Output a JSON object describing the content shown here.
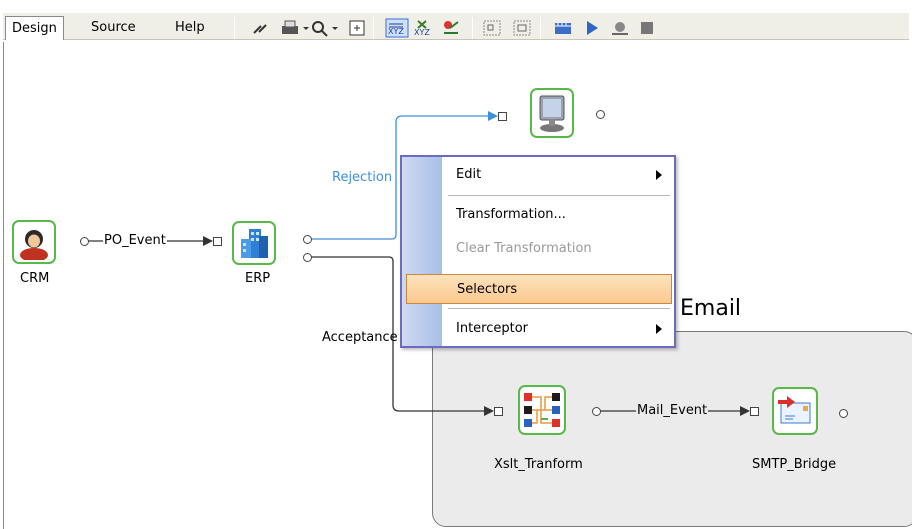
{
  "toolbar": {
    "tabs": [
      {
        "label": "Design",
        "active": true
      },
      {
        "label": "Source",
        "active": false
      },
      {
        "label": "Help",
        "active": false
      }
    ],
    "buttons": [
      "link-icon",
      "print-icon",
      "zoom-icon",
      "fit-icon",
      "xyz-icon",
      "xyz-layout-icon",
      "filter-icon",
      "group-icon",
      "ungroup-icon",
      "film-icon",
      "play-icon",
      "debug-icon",
      "stop-icon"
    ]
  },
  "nodes": {
    "crm": {
      "label": "CRM"
    },
    "erp": {
      "label": "ERP"
    },
    "terminal": {
      "label": ""
    },
    "xslt": {
      "label": "Xslt_Tranform"
    },
    "smtp": {
      "label": "SMTP_Bridge"
    }
  },
  "connections": {
    "po_event": "PO_Event",
    "rejection": "Rejection",
    "acceptance": "Acceptance",
    "mail_event": "Mail_Event"
  },
  "group": {
    "label": "Email"
  },
  "context_menu": {
    "items": [
      {
        "label": "Edit",
        "submenu": true
      },
      {
        "label": "Transformation...",
        "submenu": false
      },
      {
        "label": "Clear Transformation",
        "submenu": false,
        "disabled": true
      },
      {
        "label": "Selectors",
        "submenu": false,
        "highlighted": true
      },
      {
        "label": "Interceptor",
        "submenu": true
      }
    ]
  },
  "colors": {
    "node_border": "#58b848",
    "rejection_link": "#3d8fdd",
    "menu_border": "#6e6ac2",
    "menu_highlight": "#fbc98f"
  }
}
